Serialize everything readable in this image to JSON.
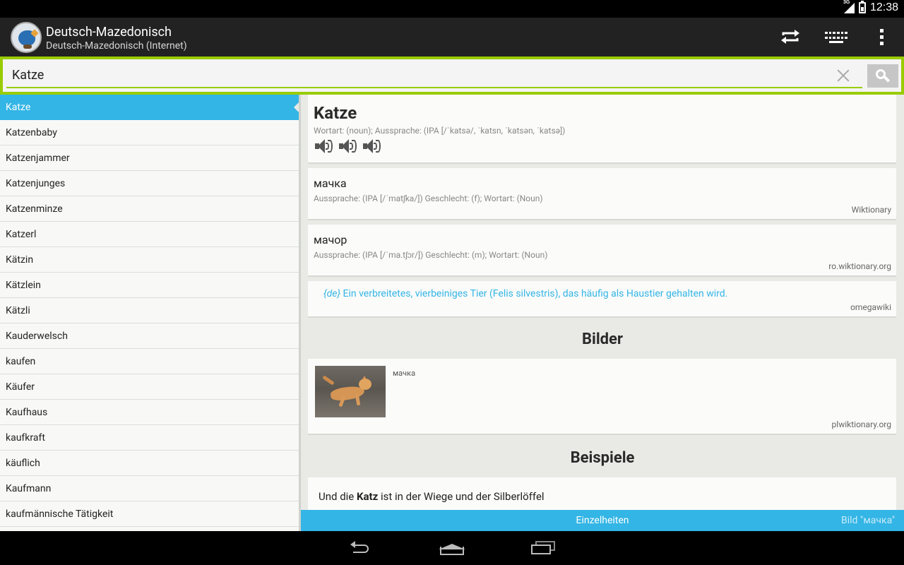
{
  "status_bar": {
    "network": "3G",
    "time": "12:38"
  },
  "app": {
    "title": "Deutsch-Mazedonisch",
    "subtitle": "Deutsch-Mazedonisch (Internet)",
    "icons": [
      "swap-direction-icon",
      "keyboard-icon",
      "overflow-menu-icon"
    ]
  },
  "search": {
    "value": "Katze",
    "placeholder": ""
  },
  "word_list": [
    "Katze",
    "Katzenbaby",
    "Katzenjammer",
    "Katzenjunges",
    "Katzenminze",
    "Katzerl",
    "Kätzin",
    "Kätzlein",
    "Kätzli",
    "Kauderwelsch",
    "kaufen",
    "Käufer",
    "Kaufhaus",
    "kaufkraft",
    "käuflich",
    "Kaufmann",
    "kaufmännische Tätigkeit"
  ],
  "entry": {
    "headword": "Katze",
    "meta": "Wortart: (noun); Aussprache: (IPA [/ˈkatsə/, ˈkatsn, ˈkatsən, ˈkatsə])"
  },
  "translations": [
    {
      "word": "мачка",
      "meta": "Aussprache: (IPA [/ˈmatʃka/]) Geschlecht: (f); Wortart: (Noun)",
      "source": "Wiktionary"
    },
    {
      "word": "мачор",
      "meta": "Aussprache: (IPA [/ˈma.tʃɔr/]) Geschlecht: (m); Wortart: (Noun)",
      "source": "ro.wiktionary.org"
    }
  ],
  "definition": {
    "lang": "{de}",
    "text": "Ein verbreitetes, vierbeiniges Tier (Felis silvestris), das häufig als Haustier gehalten wird.",
    "source": "omegawiki"
  },
  "images_section": {
    "title": "Bilder",
    "caption": "мачка",
    "source": "plwiktionary.org"
  },
  "examples_section": {
    "title": "Beispiele",
    "before": "Und die ",
    "bold": "Katz",
    "after": " ist in der Wiege und der Silberlöffel"
  },
  "bottom_tabs": {
    "details": "Einzelheiten",
    "image": "Bild \"мачка\""
  },
  "colors": {
    "accent_blue": "#33b5e5",
    "accent_green": "#99cc00",
    "actionbar": "#222222"
  }
}
